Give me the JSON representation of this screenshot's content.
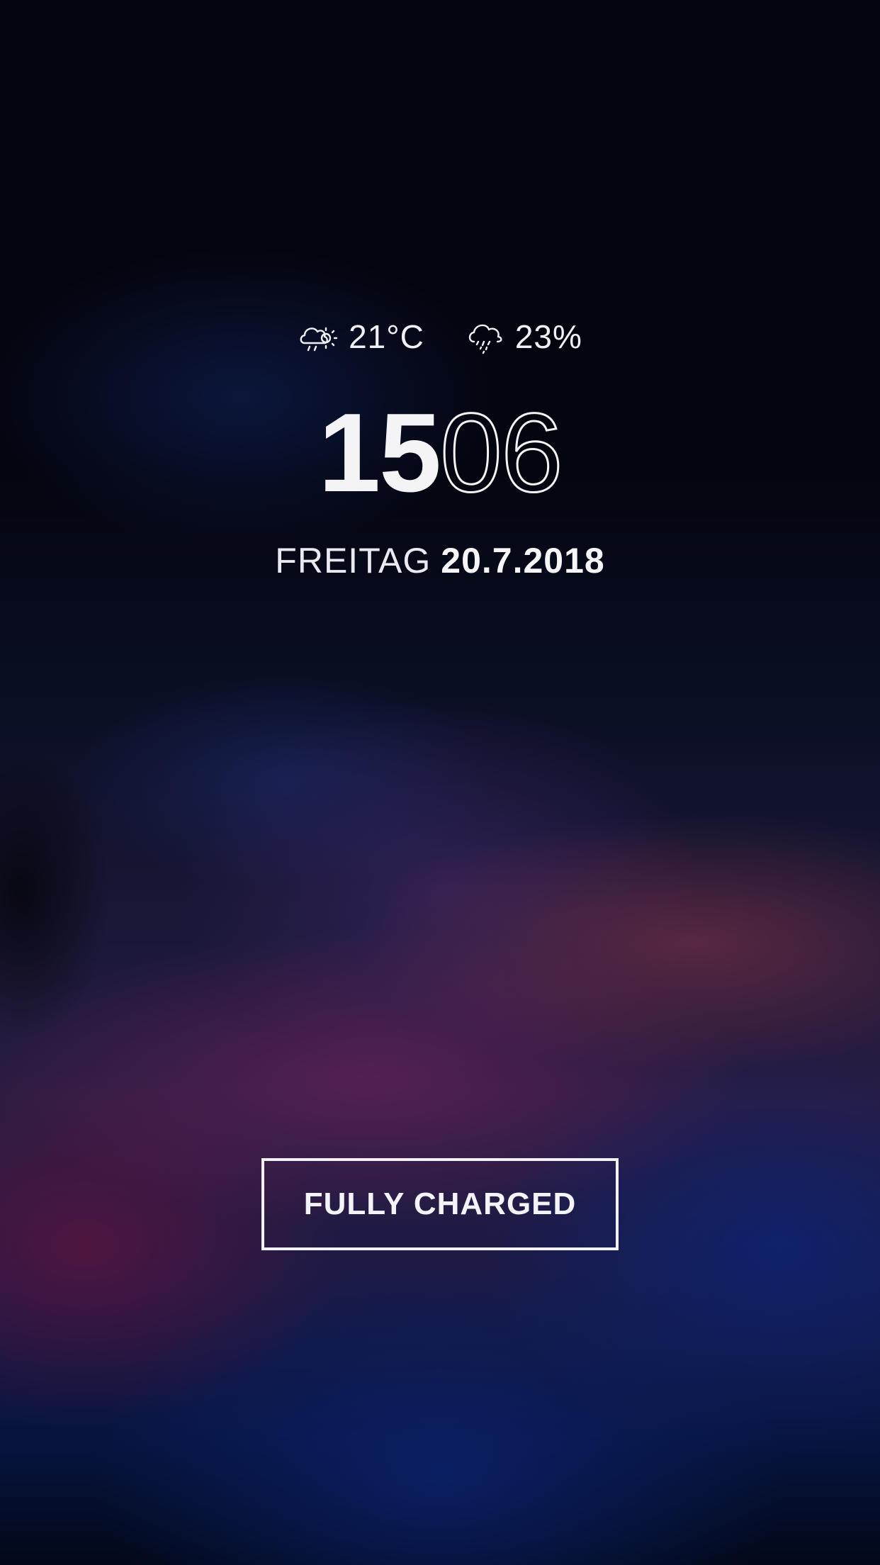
{
  "weather": {
    "temperature": "21°C",
    "temperature_icon": "partly-cloudy-icon",
    "precipitation": "23%",
    "precipitation_icon": "rain-cloud-icon"
  },
  "clock": {
    "hours": "15",
    "minutes": "06"
  },
  "date": {
    "weekday": "FREITAG",
    "date": "20.7.2018"
  },
  "battery": {
    "status_label": "FULLY CHARGED"
  },
  "colors": {
    "text": "#f3f4f8",
    "background_top": "#03050d",
    "accent_magenta": "#7a2456",
    "accent_blue": "#0a2478"
  }
}
